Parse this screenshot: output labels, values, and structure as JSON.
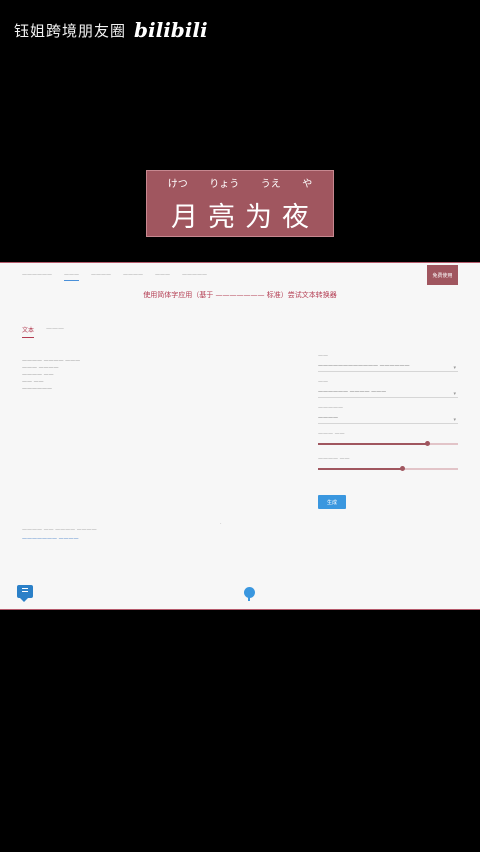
{
  "video": {
    "channel": "钰姐跨境朋友圈",
    "logo": "bilibili",
    "title": "月亮为夜",
    "ruby": [
      "けつ",
      "りょう",
      "うえ",
      "や"
    ]
  },
  "app": {
    "nav": [
      "——————",
      "———",
      "————",
      "————",
      "———",
      "—————"
    ],
    "cta_label": "免费使用",
    "headline": "使用简体字应用（基于 ——————— 标准）尝试文本转换器",
    "tabs": [
      "文本",
      "———"
    ],
    "text_lines": [
      "———— ———— ———",
      "——— ————",
      "———— ——",
      "—— ——",
      "——————"
    ],
    "center_marker": "·",
    "status": "———— —— ———— ————",
    "status_link": "——————— ————",
    "settings": {
      "fields": [
        {
          "label": "——",
          "value": "————————————  ——————"
        },
        {
          "label": "——",
          "value": "——————  ————  ———"
        },
        {
          "label": "—————",
          "value": "————"
        }
      ],
      "sliders": [
        {
          "label": "——— ——",
          "value": 0.78
        },
        {
          "label": "———— ——",
          "value": 0.6
        }
      ],
      "generate_label": "生成"
    }
  }
}
